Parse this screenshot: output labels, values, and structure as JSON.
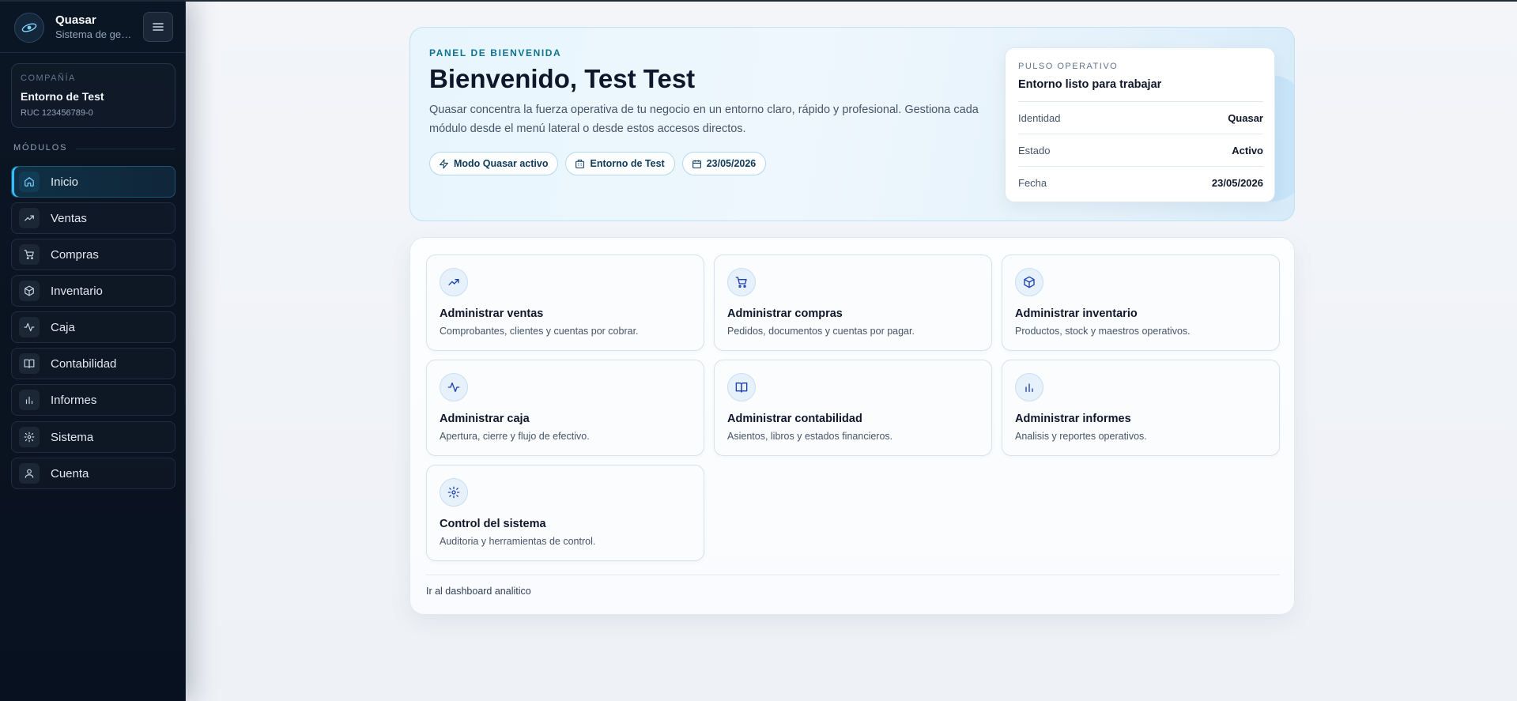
{
  "brand": {
    "title": "Quasar",
    "subtitle": "Sistema de gestión"
  },
  "company": {
    "label": "COMPAÑÍA",
    "name": "Entorno de Test",
    "ruc": "RUC 123456789-0"
  },
  "modules_title": "MÓDULOS",
  "nav": [
    {
      "label": "Inicio",
      "icon": "home-icon",
      "active": true
    },
    {
      "label": "Ventas",
      "icon": "trending-up-icon"
    },
    {
      "label": "Compras",
      "icon": "cart-icon"
    },
    {
      "label": "Inventario",
      "icon": "box-icon"
    },
    {
      "label": "Caja",
      "icon": "activity-icon"
    },
    {
      "label": "Contabilidad",
      "icon": "book-icon"
    },
    {
      "label": "Informes",
      "icon": "bar-chart-icon"
    },
    {
      "label": "Sistema",
      "icon": "gear-icon"
    },
    {
      "label": "Cuenta",
      "icon": "user-icon"
    }
  ],
  "hero": {
    "kicker": "PANEL DE BIENVENIDA",
    "title": "Bienvenido, Test Test",
    "description": "Quasar concentra la fuerza operativa de tu negocio en un entorno claro, rápido y profesional. Gestiona cada módulo desde el menú lateral o desde estos accesos directos.",
    "chips": [
      {
        "label": "Modo Quasar activo",
        "icon": "zap-icon"
      },
      {
        "label": "Entorno de Test",
        "icon": "building-icon"
      },
      {
        "label": "23/05/2026",
        "icon": "calendar-icon"
      }
    ]
  },
  "pulse": {
    "kicker": "PULSO OPERATIVO",
    "title": "Entorno listo para trabajar",
    "rows": [
      {
        "key": "Identidad",
        "value": "Quasar"
      },
      {
        "key": "Estado",
        "value": "Activo"
      },
      {
        "key": "Fecha",
        "value": "23/05/2026"
      }
    ]
  },
  "tiles": [
    {
      "title": "Administrar ventas",
      "desc": "Comprobantes, clientes y cuentas por cobrar.",
      "icon": "trending-up-icon"
    },
    {
      "title": "Administrar compras",
      "desc": "Pedidos, documentos y cuentas por pagar.",
      "icon": "cart-icon"
    },
    {
      "title": "Administrar inventario",
      "desc": "Productos, stock y maestros operativos.",
      "icon": "box-icon"
    },
    {
      "title": "Administrar caja",
      "desc": "Apertura, cierre y flujo de efectivo.",
      "icon": "activity-icon"
    },
    {
      "title": "Administrar contabilidad",
      "desc": "Asientos, libros y estados financieros.",
      "icon": "book-icon"
    },
    {
      "title": "Administrar informes",
      "desc": "Analisis y reportes operativos.",
      "icon": "bar-chart-icon"
    },
    {
      "title": "Control del sistema",
      "desc": "Auditoria y herramientas de control.",
      "icon": "gear-icon"
    }
  ],
  "footer_link": "Ir al dashboard analitico",
  "colors": {
    "sidebar_bg": "#0b1624",
    "accent": "#38bdf8",
    "hero_bg": "#e8f5fd",
    "tile_icon": "#1e40af"
  }
}
